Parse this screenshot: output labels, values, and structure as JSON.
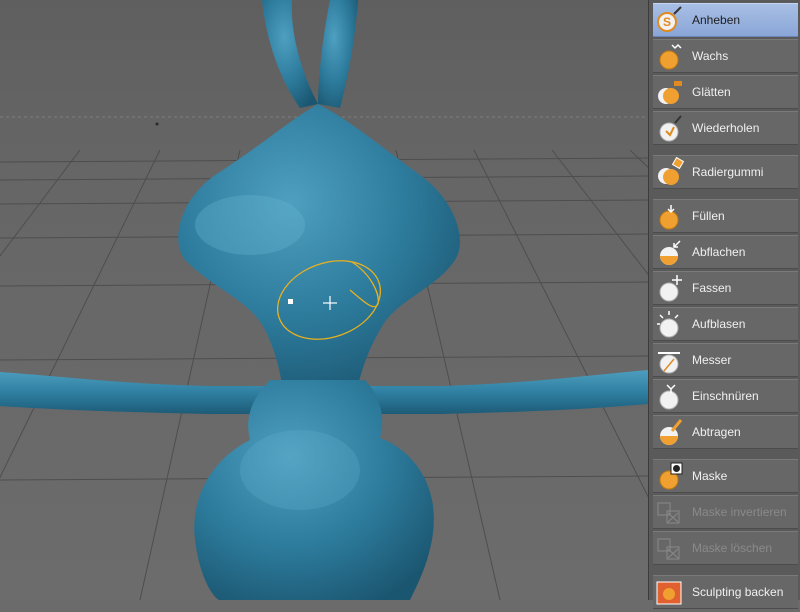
{
  "tools_group1": [
    {
      "label": "Anheben",
      "icon": "brush-pull-icon",
      "active": true
    },
    {
      "label": "Wachs",
      "icon": "wax-sphere-icon",
      "active": false
    },
    {
      "label": "Glätten",
      "icon": "smooth-sphere-icon",
      "active": false
    },
    {
      "label": "Wiederholen",
      "icon": "repeat-brush-icon",
      "active": false
    }
  ],
  "tools_group2": [
    {
      "label": "Radiergummi",
      "icon": "eraser-icon",
      "active": false
    }
  ],
  "tools_group3": [
    {
      "label": "Füllen",
      "icon": "fill-icon",
      "active": false
    },
    {
      "label": "Abflachen",
      "icon": "flatten-icon",
      "active": false
    },
    {
      "label": "Fassen",
      "icon": "grab-icon",
      "active": false
    },
    {
      "label": "Aufblasen",
      "icon": "inflate-icon",
      "active": false
    },
    {
      "label": "Messer",
      "icon": "knife-icon",
      "active": false
    },
    {
      "label": "Einschnüren",
      "icon": "pinch-icon",
      "active": false
    },
    {
      "label": "Abtragen",
      "icon": "scrape-icon",
      "active": false
    }
  ],
  "tools_group4": [
    {
      "label": "Maske",
      "icon": "mask-icon",
      "active": false,
      "disabled": false
    },
    {
      "label": "Maske invertieren",
      "icon": "mask-invert-icon",
      "active": false,
      "disabled": true
    },
    {
      "label": "Maske löschen",
      "icon": "mask-clear-icon",
      "active": false,
      "disabled": true
    }
  ],
  "tools_group5": [
    {
      "label": "Sculpting backen",
      "icon": "bake-icon",
      "active": false
    }
  ],
  "colors": {
    "model": "#2f7f9f",
    "brush_ring": "#e8b020",
    "active_tool": "#9bb3df",
    "sphere_orange": "#f0a030"
  }
}
